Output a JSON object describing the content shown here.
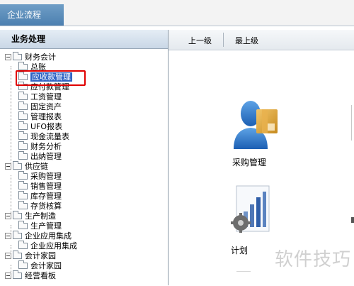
{
  "top_tab": "企业流程",
  "left_header": "业务处理",
  "tree": {
    "finance": "财务会计",
    "ledger": "总账",
    "receivables": "应收款管理",
    "payables": "应付款管理",
    "salary": "工资管理",
    "fixed_assets": "固定资产",
    "mgmt_reports": "管理报表",
    "ufo_reports": "UFO报表",
    "cash_flow": "现金流量表",
    "fin_analysis": "财务分析",
    "cashier": "出纳管理",
    "supply_chain": "供应链",
    "purchase_mgmt": "采购管理",
    "sales_mgmt": "销售管理",
    "inventory_mgmt": "库存管理",
    "stock_accounting": "存货核算",
    "production": "生产制造",
    "production_mgmt": "生产管理",
    "enterprise_integration": "企业应用集成",
    "enterprise_integration_child": "企业应用集成",
    "accountant_home": "会计家园",
    "accountant_home_child": "会计家园",
    "dashboard": "经营看板"
  },
  "toolbar": {
    "up": "上一级",
    "top": "最上级"
  },
  "main": {
    "purchase_label": "采购管理",
    "plan_label": "计划"
  },
  "watermark": "软件技巧",
  "colors": {
    "selected_bg": "#2f64c4",
    "highlight_border": "#e00000",
    "tab_bg": "#5b8cba"
  },
  "icons": {
    "purchase": "person-with-box-icon",
    "plan": "chart-with-gear-icon"
  }
}
